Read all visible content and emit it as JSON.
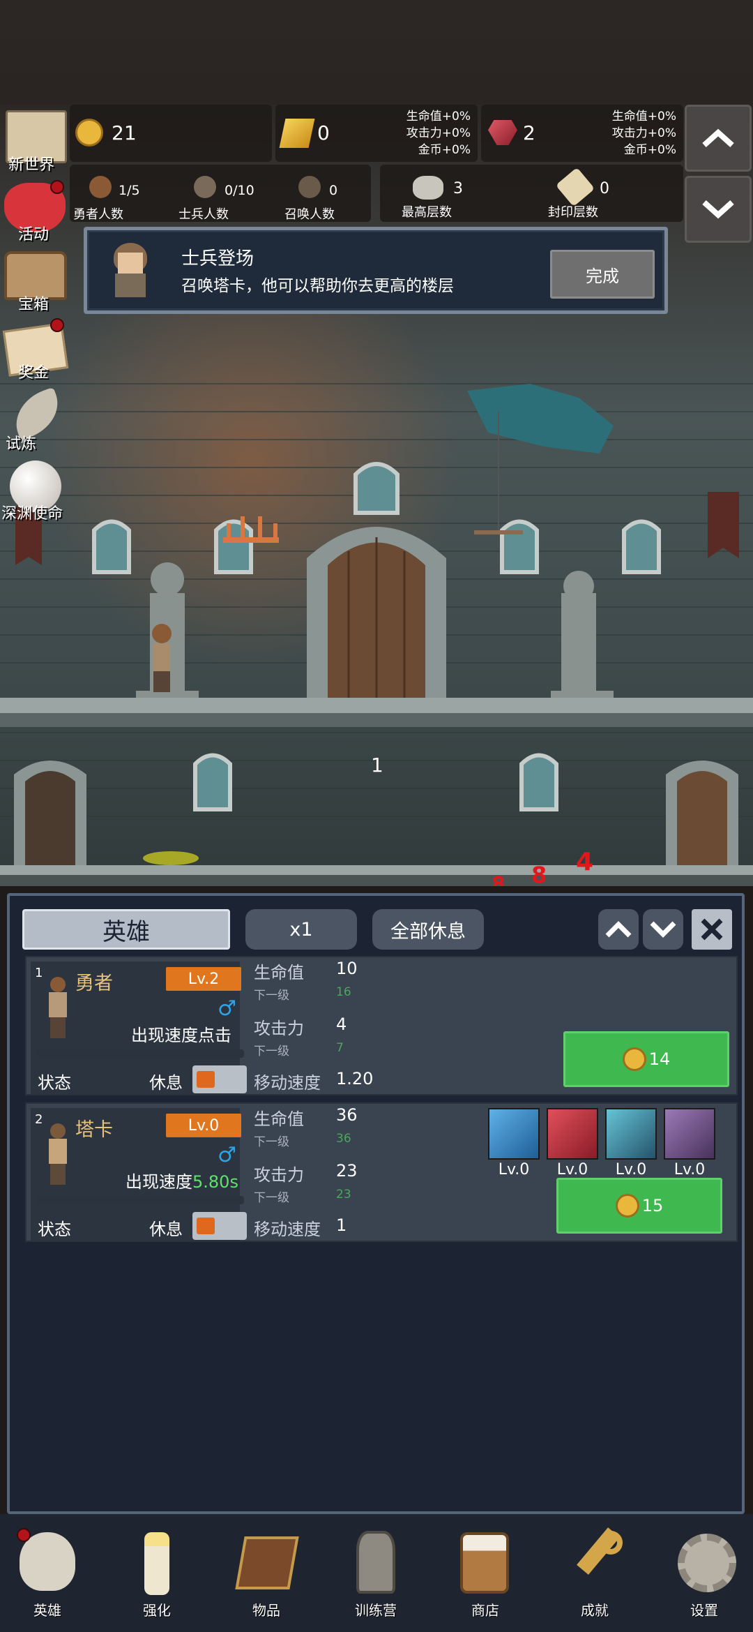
{
  "resources": {
    "gold": "21",
    "gold_bar": "0",
    "gem": "2",
    "bonus_hp": "生命值+0%",
    "bonus_atk": "攻击力+0%",
    "bonus_coin": "金币+0%",
    "bonus_hp2": "生命值+0%",
    "bonus_atk2": "攻击力+0%",
    "bonus_coin2": "金币+0%"
  },
  "counts": {
    "hero_count": "1/5",
    "hero_label": "勇者人数",
    "soldier_count": "0/10",
    "soldier_label": "士兵人数",
    "summon_count": "0",
    "summon_label": "召唤人数",
    "max_floor": "3",
    "max_floor_label": "最高层数",
    "sealed_floor": "0",
    "sealed_floor_label": "封印层数"
  },
  "side_menu": [
    {
      "label": "新世界"
    },
    {
      "label": "活动"
    },
    {
      "label": "宝箱"
    },
    {
      "label": "奖金"
    },
    {
      "label": "试炼"
    },
    {
      "label": "深渊使命"
    }
  ],
  "quest": {
    "title": "士兵登场",
    "description": "召唤塔卡，他可以帮助你去更高的楼层",
    "button": "完成"
  },
  "scene": {
    "floor_number": "1",
    "damage_numbers": [
      "4",
      "8",
      "8"
    ]
  },
  "panel": {
    "tab_hero": "英雄",
    "speed_button": "x1",
    "rest_all_button": "全部休息"
  },
  "heroes": [
    {
      "index": "1",
      "name": "勇者",
      "level": "Lv.2",
      "spawn_text": "出现速度点击",
      "status_label": "状态",
      "rest_label": "休息",
      "hp_label": "生命值",
      "hp": "10",
      "hp_next_label": "下一级",
      "hp_next": "16",
      "atk_label": "攻击力",
      "atk": "4",
      "atk_next_label": "下一级",
      "atk_next": "7",
      "speed_label": "移动速度",
      "speed": "1.20",
      "upgrade_cost": "14"
    },
    {
      "index": "2",
      "name": "塔卡",
      "level": "Lv.0",
      "spawn_text": "出现速度",
      "spawn_time": "5.80s",
      "status_label": "状态",
      "rest_label": "休息",
      "hp_label": "生命值",
      "hp": "36",
      "hp_next_label": "下一级",
      "hp_next": "36",
      "atk_label": "攻击力",
      "atk": "23",
      "atk_next_label": "下一级",
      "atk_next": "23",
      "speed_label": "移动速度",
      "speed": "1",
      "upgrade_cost": "15",
      "skills": [
        {
          "icon": "shield-skill-icon",
          "level": "Lv.0"
        },
        {
          "icon": "axe-skill-icon",
          "level": "Lv.0"
        },
        {
          "icon": "boot-skill-icon",
          "level": "Lv.0"
        },
        {
          "icon": "hammer-skill-icon",
          "level": "Lv.0"
        }
      ]
    }
  ],
  "nav": [
    {
      "label": "英雄",
      "icon": "skull-icon"
    },
    {
      "label": "强化",
      "icon": "candle-icon"
    },
    {
      "label": "物品",
      "icon": "book-icon"
    },
    {
      "label": "训练营",
      "icon": "lantern-icon"
    },
    {
      "label": "商店",
      "icon": "beer-mug-icon"
    },
    {
      "label": "成就",
      "icon": "key-icon"
    },
    {
      "label": "设置",
      "icon": "gear-icon"
    }
  ]
}
